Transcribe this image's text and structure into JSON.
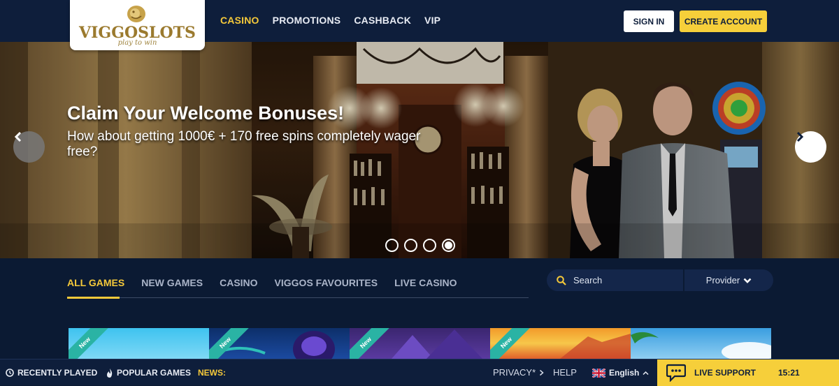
{
  "brand": {
    "name": "VIGGOSLOTS",
    "tagline": "play to win"
  },
  "nav": {
    "items": [
      "CASINO",
      "PROMOTIONS",
      "CASHBACK",
      "VIP"
    ],
    "active": "CASINO"
  },
  "header": {
    "sign_in": "SIGN IN",
    "create_account": "CREATE ACCOUNT"
  },
  "hero": {
    "title": "Claim Your Welcome Bonuses!",
    "subtitle": "How about getting 1000€ + 170 free spins completely wager free?",
    "slide_count": 4,
    "active_slide": 4
  },
  "games": {
    "tabs": [
      "ALL GAMES",
      "NEW GAMES",
      "CASINO",
      "VIGGOS FAVOURITES",
      "LIVE CASINO"
    ],
    "active_tab": "ALL GAMES",
    "search_placeholder": "Search",
    "provider_label": "Provider",
    "tiles": [
      {
        "badge": "New"
      },
      {
        "badge": "New"
      },
      {
        "badge": "New"
      },
      {
        "badge": "New"
      },
      {
        "badge": ""
      }
    ]
  },
  "footer": {
    "recently_played": "RECENTLY PLAYED",
    "popular_games": "POPULAR GAMES",
    "news": "NEWS:",
    "privacy": "PRIVACY*",
    "help": "HELP",
    "language": "English",
    "live_support": "LIVE SUPPORT",
    "time": "15:21"
  },
  "colors": {
    "accent": "#f6cf3a",
    "header_bg": "#0e1e3b",
    "page_bg": "#0b1a33",
    "ribbon": "#2ab3a4"
  }
}
